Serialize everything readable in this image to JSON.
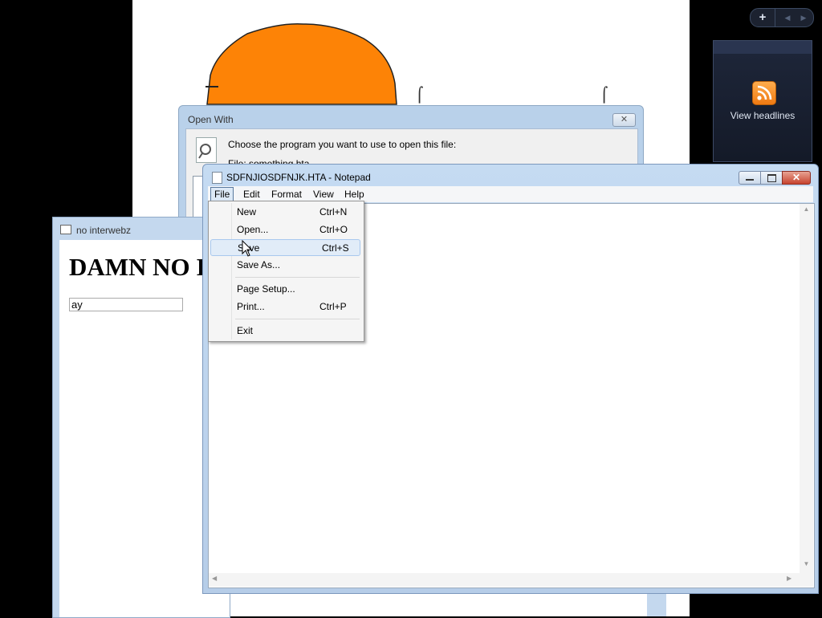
{
  "sidebar": {
    "add_label": "+",
    "prev_label": "◀",
    "next_label": "▶",
    "gadget": {
      "icon": "rss-icon",
      "label": "View headlines",
      "accent": "#f08a1c"
    }
  },
  "open_with": {
    "title": "Open With",
    "close_label": "✕",
    "prompt": "Choose the program you want to use to open this file:",
    "file_text": "File:    something.hta"
  },
  "hta_window": {
    "title": "no interwebz",
    "heading": "DAMN NO I",
    "input_value": "ay"
  },
  "notepad": {
    "title": "SDFNJIOSDFNJK.HTA - Notepad",
    "close_label": "✕",
    "menu": {
      "file": "File",
      "edit": "Edit",
      "format": "Format",
      "view": "View",
      "help": "Help"
    },
    "scroll": {
      "up": "▲",
      "down": "▼",
      "left": "◀",
      "right": "▶"
    }
  },
  "file_menu": {
    "items": [
      {
        "label": "New",
        "accelerator": "Ctrl+N"
      },
      {
        "label": "Open...",
        "accelerator": "Ctrl+O"
      },
      {
        "label": "Save",
        "accelerator": "Ctrl+S",
        "highlighted": true
      },
      {
        "label": "Save As...",
        "accelerator": ""
      },
      {
        "label": "Page Setup...",
        "accelerator": ""
      },
      {
        "label": "Print...",
        "accelerator": "Ctrl+P"
      },
      {
        "label": "Exit",
        "accelerator": ""
      }
    ]
  },
  "colors": {
    "orange_shape": "#fd8306",
    "title_bar": "#c5dbf2",
    "desktop": "#000000"
  }
}
